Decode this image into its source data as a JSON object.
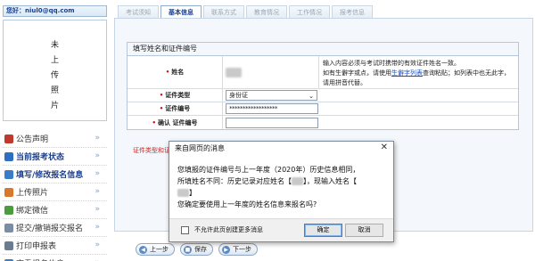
{
  "user": {
    "label": "您好：niul0@qq.com"
  },
  "photo": {
    "label": "未上传照片"
  },
  "menu": {
    "items": [
      {
        "label": "公告声明",
        "bold": false,
        "color": "#c0392b"
      },
      {
        "label": "当前报考状态",
        "bold": true,
        "color": "#2e6fc2"
      },
      {
        "label": "填写/修改报名信息",
        "bold": true,
        "color": "#3a7dc9"
      },
      {
        "label": "上传照片",
        "bold": false,
        "color": "#d9772a"
      },
      {
        "label": "绑定微信",
        "bold": false,
        "color": "#4a9c3c"
      },
      {
        "label": "提交/撤销报交报名",
        "bold": false,
        "color": "#7b8da3"
      },
      {
        "label": "打印申报表",
        "bold": false,
        "color": "#6b7c90"
      },
      {
        "label": "查看报名信息",
        "bold": false,
        "color": "#3a7dc9"
      }
    ]
  },
  "tabs": [
    {
      "label": "考试须知",
      "active": false
    },
    {
      "label": "基本信息",
      "active": true
    },
    {
      "label": "联系方式",
      "active": false
    },
    {
      "label": "教育情况",
      "active": false
    },
    {
      "label": "工作情况",
      "active": false
    },
    {
      "label": "报考信息",
      "active": false
    }
  ],
  "form": {
    "header": "填写姓名和证件编号",
    "name_label": "姓名",
    "name_note_a": "输入内容必须与考试时携带的有效证件姓名一致。",
    "name_note_b": "如有生僻字或点，请使用",
    "name_note_link": "生僻字列表",
    "name_note_c": "查询粘贴；如列表中也无此字，请用拼音代替。",
    "id_type_label": "证件类型",
    "id_type_value": "身份证",
    "id_number_label": "证件编号",
    "id_number_value": "******************",
    "confirm_label": "确认 证件编号",
    "confirm_value": ""
  },
  "warning": "证件类型和证件编号保存后将无法修改，如保存后发现输入错误，请重新注册，妥受后再填报。",
  "nav": {
    "prev": "上一步",
    "save": "保存",
    "next": "下一步"
  },
  "dialog": {
    "title": "来自网页的消息",
    "close": "✕",
    "line1": "您填报的证件编号与上一年度（2020年）历史信息相同，",
    "line2a": "所填姓名不同：历史记录对应姓名【",
    "line2b": "】，现输入姓名【",
    "line2c": "】",
    "line3": "您确定要使用上一年度的姓名信息来报名吗?",
    "checkbox_label": "不允许此页创建更多消息",
    "ok": "确定",
    "cancel": "取消"
  }
}
